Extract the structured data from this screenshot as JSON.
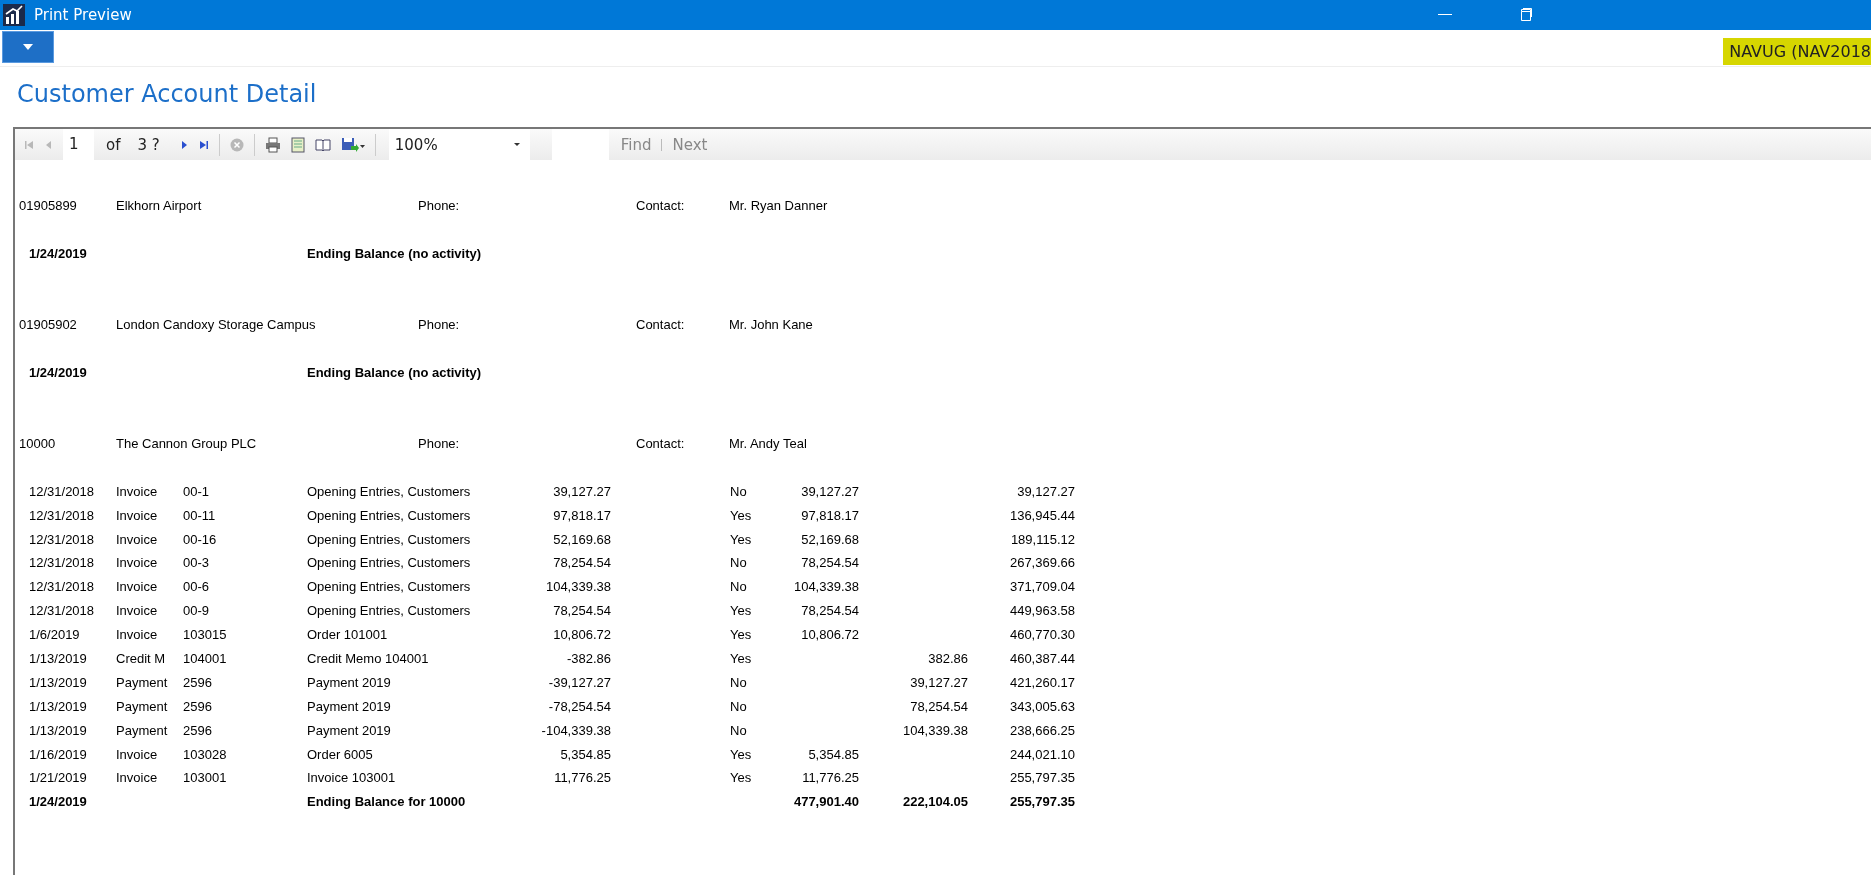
{
  "window": {
    "title": "Print Preview"
  },
  "environment_badge": "NAVUG (NAV2018",
  "report_title": "Customer Account Detail",
  "toolbar": {
    "nav_buttons": [
      {
        "kind": "first",
        "disabled": true
      },
      {
        "kind": "previous",
        "disabled": true
      }
    ],
    "page": "1",
    "of_label": "of",
    "page_count": "3 ?",
    "nav_buttons_after": [
      {
        "kind": "next",
        "disabled": false
      },
      {
        "kind": "last",
        "disabled": false
      }
    ],
    "stop_disabled": true,
    "zoom": "100%",
    "find_label": "Find",
    "next_label": "Next"
  },
  "customers": [
    {
      "no": "01905899",
      "name": "Elkhorn Airport",
      "phone_label": "Phone:",
      "contact_label": "Contact:",
      "contact": "Mr. Ryan Danner",
      "ending": {
        "kind": "no_activity",
        "date": "1/24/2019",
        "label": "Ending Balance (no activity)"
      }
    },
    {
      "no": "01905902",
      "name": "London Candoxy Storage Campus",
      "phone_label": "Phone:",
      "contact_label": "Contact:",
      "contact": "Mr. John Kane",
      "ending": {
        "kind": "no_activity",
        "date": "1/24/2019",
        "label": "Ending Balance (no activity)"
      }
    },
    {
      "no": "10000",
      "name": "The Cannon Group PLC",
      "phone_label": "Phone:",
      "contact_label": "Contact:",
      "contact": "Mr. Andy Teal",
      "entries": [
        {
          "date": "12/31/2018",
          "type": "Invoice",
          "doc": "00-1",
          "description": "Opening Entries, Customers",
          "amount": "39,127.27",
          "open": "No",
          "debit": "39,127.27",
          "balance": "39,127.27"
        },
        {
          "date": "12/31/2018",
          "type": "Invoice",
          "doc": "00-11",
          "description": "Opening Entries, Customers",
          "amount": "97,818.17",
          "open": "Yes",
          "debit": "97,818.17",
          "balance": "136,945.44"
        },
        {
          "date": "12/31/2018",
          "type": "Invoice",
          "doc": "00-16",
          "description": "Opening Entries, Customers",
          "amount": "52,169.68",
          "open": "Yes",
          "debit": "52,169.68",
          "balance": "189,115.12"
        },
        {
          "date": "12/31/2018",
          "type": "Invoice",
          "doc": "00-3",
          "description": "Opening Entries, Customers",
          "amount": "78,254.54",
          "open": "No",
          "debit": "78,254.54",
          "balance": "267,369.66"
        },
        {
          "date": "12/31/2018",
          "type": "Invoice",
          "doc": "00-6",
          "description": "Opening Entries, Customers",
          "amount": "104,339.38",
          "open": "No",
          "debit": "104,339.38",
          "balance": "371,709.04"
        },
        {
          "date": "12/31/2018",
          "type": "Invoice",
          "doc": "00-9",
          "description": "Opening Entries, Customers",
          "amount": "78,254.54",
          "open": "Yes",
          "debit": "78,254.54",
          "balance": "449,963.58"
        },
        {
          "date": "1/6/2019",
          "type": "Invoice",
          "doc": "103015",
          "description": "Order 101001",
          "amount": "10,806.72",
          "open": "Yes",
          "debit": "10,806.72",
          "balance": "460,770.30"
        },
        {
          "date": "1/13/2019",
          "type": "Credit M",
          "doc": "104001",
          "description": "Credit Memo 104001",
          "amount": "-382.86",
          "open": "Yes",
          "credit": "382.86",
          "balance": "460,387.44"
        },
        {
          "date": "1/13/2019",
          "type": "Payment",
          "doc": "2596",
          "description": "Payment 2019",
          "amount": "-39,127.27",
          "open": "No",
          "credit": "39,127.27",
          "balance": "421,260.17"
        },
        {
          "date": "1/13/2019",
          "type": "Payment",
          "doc": "2596",
          "description": "Payment 2019",
          "amount": "-78,254.54",
          "open": "No",
          "credit": "78,254.54",
          "balance": "343,005.63"
        },
        {
          "date": "1/13/2019",
          "type": "Payment",
          "doc": "2596",
          "description": "Payment 2019",
          "amount": "-104,339.38",
          "open": "No",
          "credit": "104,339.38",
          "balance": "238,666.25"
        },
        {
          "date": "1/16/2019",
          "type": "Invoice",
          "doc": "103028",
          "description": "Order 6005",
          "amount": "5,354.85",
          "open": "Yes",
          "debit": "5,354.85",
          "balance": "244,021.10"
        },
        {
          "date": "1/21/2019",
          "type": "Invoice",
          "doc": "103001",
          "description": "Invoice 103001",
          "amount": "11,776.25",
          "open": "Yes",
          "debit": "11,776.25",
          "balance": "255,797.35"
        }
      ],
      "ending": {
        "kind": "totals",
        "date": "1/24/2019",
        "label": "Ending Balance for 10000",
        "debit": "477,901.40",
        "credit": "222,104.05",
        "balance": "255,797.35"
      }
    }
  ]
}
